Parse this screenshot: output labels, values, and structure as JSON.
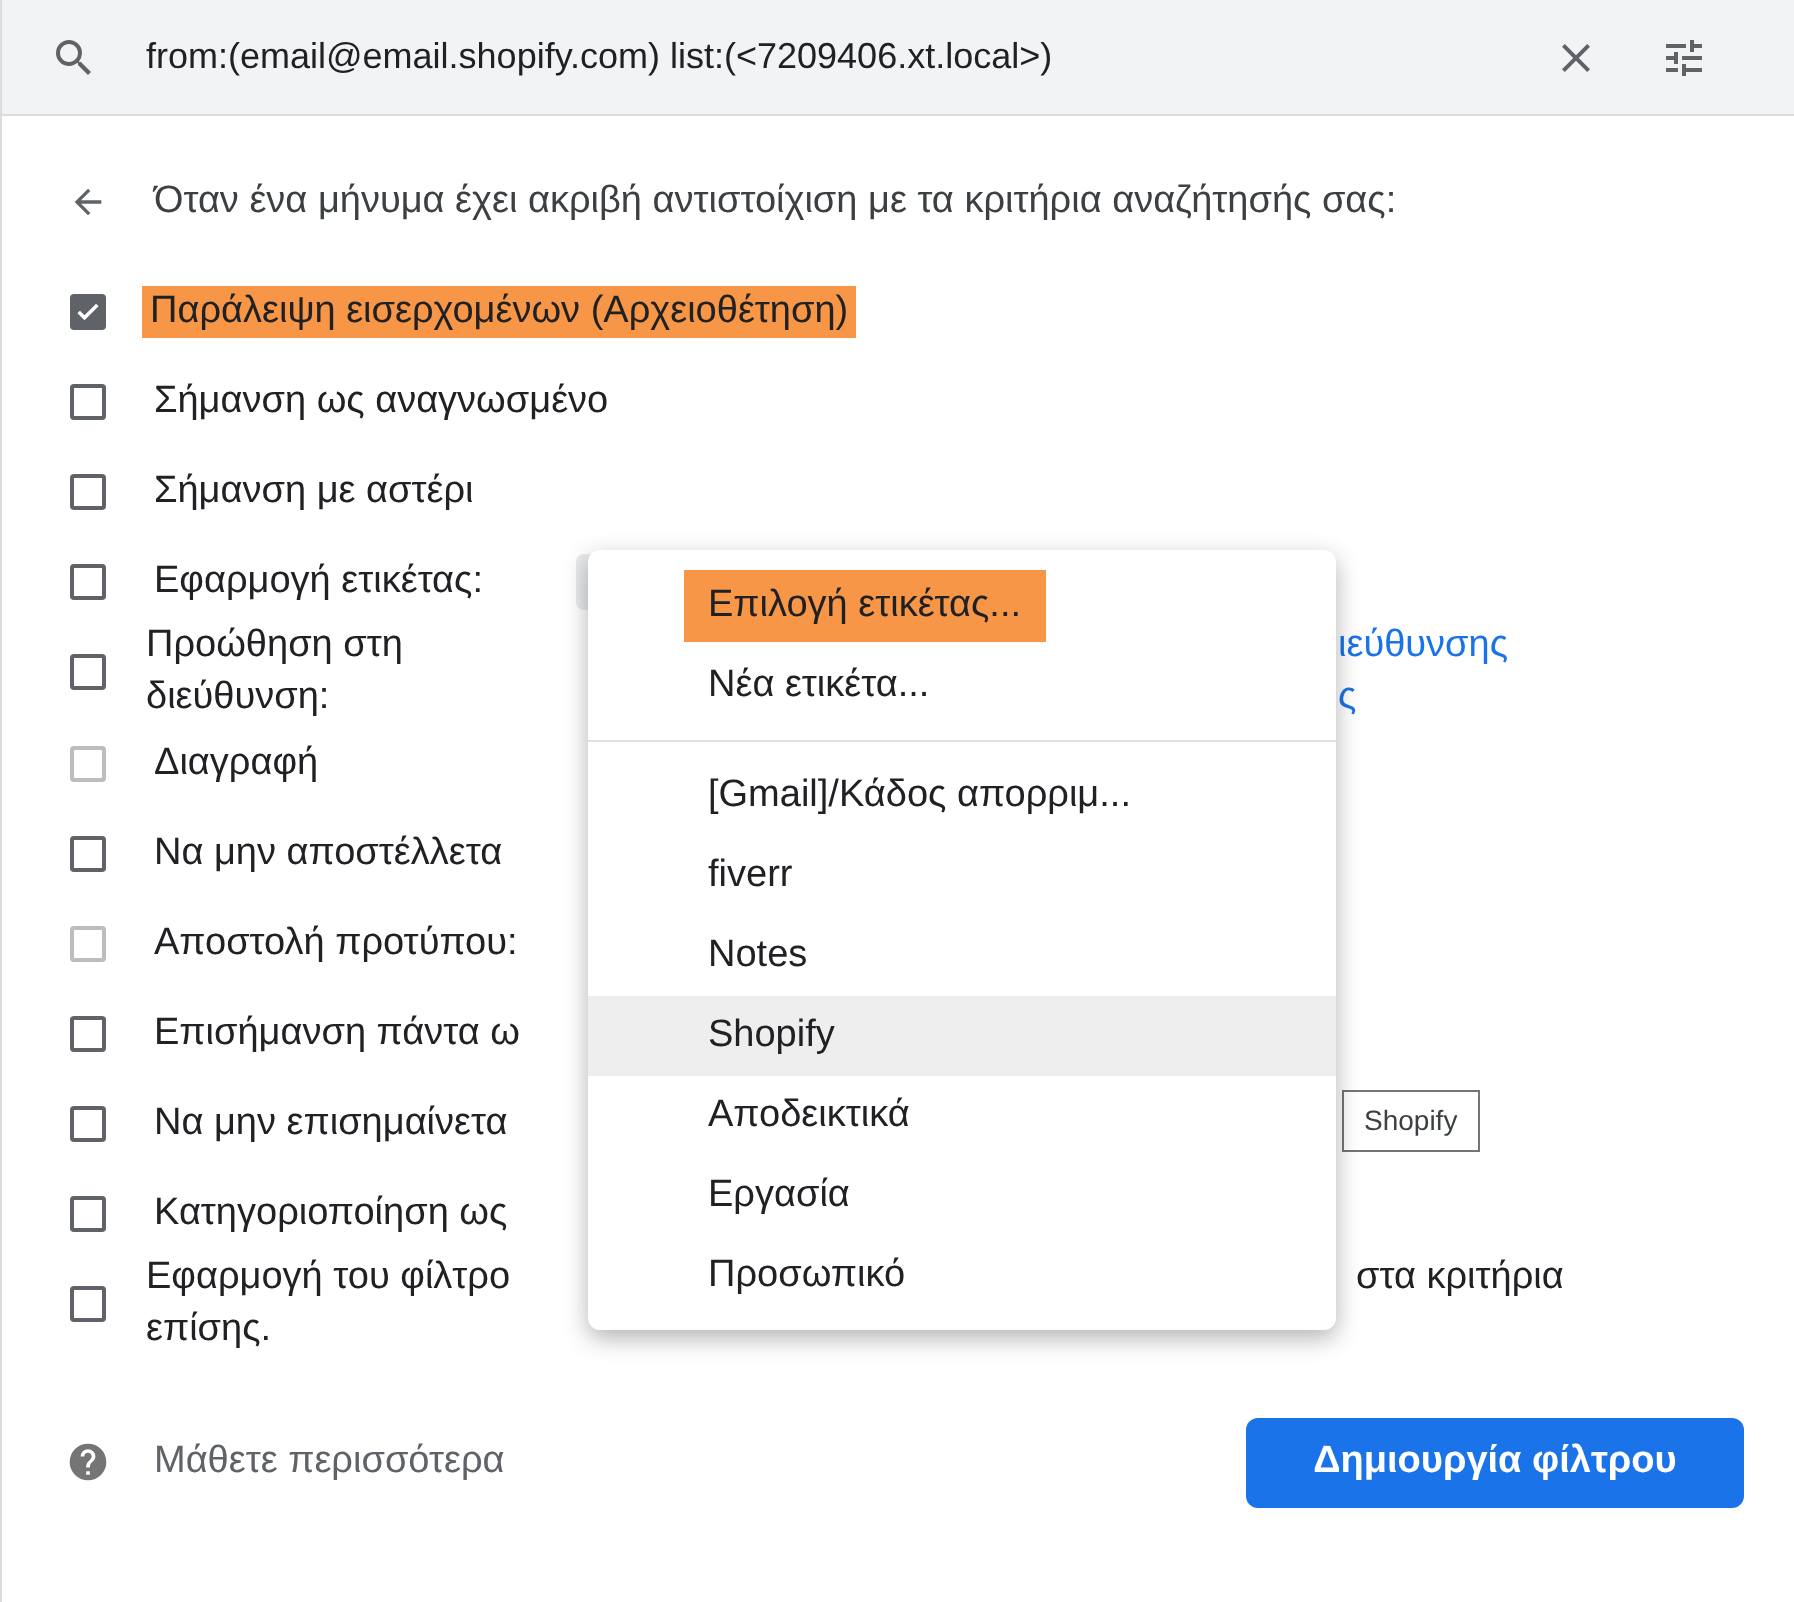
{
  "search": {
    "query": "from:(email@email.shopify.com) list:(<7209406.xt.local>)"
  },
  "heading": "Όταν ένα μήνυμα έχει ακριβή αντιστοίχιση με τα κριτήρια αναζήτησής σας:",
  "actions": [
    {
      "lines": [
        "Παράλειψη εισερχομένων (Αρχειοθέτηση)"
      ],
      "checked": true,
      "disabled": false,
      "highlighted": true
    },
    {
      "lines": [
        "Σήμανση ως αναγνωσμένο"
      ],
      "checked": false,
      "disabled": false,
      "highlighted": false
    },
    {
      "lines": [
        "Σήμανση με αστέρι"
      ],
      "checked": false,
      "disabled": false,
      "highlighted": false
    },
    {
      "lines": [
        "Εφαρμογή ετικέτας:"
      ],
      "checked": false,
      "disabled": false,
      "highlighted": false,
      "trailing": {
        "kind": "select"
      }
    },
    {
      "lines": [
        "Προώθηση στη",
        "διεύθυνση:"
      ],
      "checked": false,
      "disabled": false,
      "highlighted": false,
      "trailing": {
        "kind": "link",
        "lines": [
          "ιεύθυνσης",
          "ς"
        ]
      }
    },
    {
      "lines": [
        "Διαγραφή"
      ],
      "checked": false,
      "disabled": true,
      "highlighted": false
    },
    {
      "lines": [
        "Να μην αποστέλλετα"
      ],
      "checked": false,
      "disabled": false,
      "highlighted": false
    },
    {
      "lines": [
        "Αποστολή προτύπου:"
      ],
      "checked": false,
      "disabled": true,
      "highlighted": false
    },
    {
      "lines": [
        "Επισήμανση πάντα ω"
      ],
      "checked": false,
      "disabled": false,
      "highlighted": false
    },
    {
      "lines": [
        "Να μην επισημαίνετα"
      ],
      "checked": false,
      "disabled": false,
      "highlighted": false,
      "trailing": {
        "kind": "chip",
        "lines": [
          "Shopify"
        ]
      }
    },
    {
      "lines": [
        "Κατηγοριοποίηση ως"
      ],
      "checked": false,
      "disabled": false,
      "highlighted": false
    },
    {
      "lines": [
        "Εφαρμογή του φίλτρο",
        "επίσης."
      ],
      "checked": false,
      "disabled": false,
      "highlighted": false,
      "trailing": {
        "kind": "text",
        "lines": [
          "στα κριτήρια"
        ]
      }
    }
  ],
  "menu": {
    "sections": [
      [
        {
          "label": "Επιλογή ετικέτας...",
          "selected": false,
          "highlighted": true
        },
        {
          "label": "Νέα ετικέτα...",
          "selected": false,
          "highlighted": false
        }
      ],
      [
        {
          "label": "[Gmail]/Κάδος απορριμ...",
          "selected": false,
          "highlighted": false
        },
        {
          "label": "fiverr",
          "selected": false,
          "highlighted": false
        },
        {
          "label": "Notes",
          "selected": false,
          "highlighted": false
        },
        {
          "label": "Shopify",
          "selected": true,
          "highlighted": false
        },
        {
          "label": "Αποδεικτικά",
          "selected": false,
          "highlighted": false
        },
        {
          "label": "Εργασία",
          "selected": false,
          "highlighted": false
        },
        {
          "label": "Προσωπικό",
          "selected": false,
          "highlighted": false
        }
      ]
    ]
  },
  "footer": {
    "help": "Μάθετε περισσότερα",
    "create_button": "Δημιουργία φίλτρου"
  }
}
